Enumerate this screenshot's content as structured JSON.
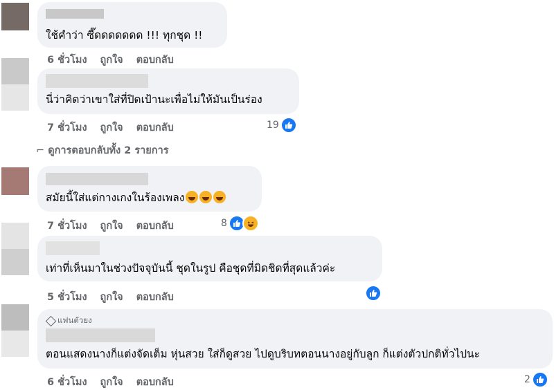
{
  "comments": [
    {
      "text": "ใช้คำว่า ซี๊ดดดดดดด !!! ทุกชุด !!",
      "time": "6 ชั่วโมง",
      "like_label": "ถูกใจ",
      "reply_label": "ตอบกลับ"
    },
    {
      "text": "นี่ว่าคิดว่าเขาใส่ที่ปิดเป้านะเพื่อไม่ให้มันเป็นร่อง",
      "time": "7 ชั่วโมง",
      "like_label": "ถูกใจ",
      "reply_label": "ตอบกลับ",
      "reaction_count": "19",
      "view_replies": "ดูการตอบกลับทั้ง 2 รายการ"
    },
    {
      "text": "สมัยนี้ใส่แต่กางเกงในร้องเพลง",
      "time": "7 ชั่วโมง",
      "like_label": "ถูกใจ",
      "reply_label": "ตอบกลับ",
      "reaction_count": "8"
    },
    {
      "text": "เท่าที่เห็นมาในช่วงปัจจุบันนี้ ชุดในรูป คือชุดที่มิดชิดที่สุดแล้วค่ะ",
      "time": "5 ชั่วโมง",
      "like_label": "ถูกใจ",
      "reply_label": "ตอบกลับ"
    },
    {
      "badge": "แฟนตัวยง",
      "text": "ตอนแสดงนางก็แต่งจัดเต็ม หุ่นสวย ใส่ก็ดูสวย ไปดูบริบทตอนนางอยู่กับลูก ก็แต่งตัวปกติทั่วไปนะ",
      "time": "6 ชั่วโมง",
      "like_label": "ถูกใจ",
      "reply_label": "ตอบกลับ",
      "reaction_count": "2"
    }
  ],
  "colors": {
    "bubble_bg": "#f0f2f5",
    "meta_text": "#65676b",
    "like_blue": "#1877f2",
    "haha_yellow": "#f7b125"
  },
  "icons": {
    "like": "thumbs-up-icon",
    "haha": "laughing-face-icon",
    "fan": "diamond-icon",
    "view_replies": "reply-arrow-icon"
  }
}
